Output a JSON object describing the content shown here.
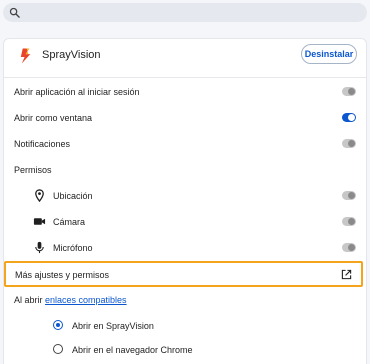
{
  "search": {
    "icon": "search-icon"
  },
  "app": {
    "name": "SprayVision",
    "logo_icon": "sprayvision-logo-icon",
    "uninstall_label": "Desinstalar"
  },
  "settings": [
    {
      "label": "Abrir aplicación al iniciar sesión",
      "enabled": false
    },
    {
      "label": "Abrir como ventana",
      "enabled": true
    },
    {
      "label": "Notificaciones",
      "enabled": false
    }
  ],
  "permissions": {
    "heading": "Permisos",
    "items": [
      {
        "label": "Ubicación",
        "icon": "location-pin-icon",
        "enabled": false
      },
      {
        "label": "Cámara",
        "icon": "camera-icon",
        "enabled": false
      },
      {
        "label": "Micrófono",
        "icon": "microphone-icon",
        "enabled": false
      }
    ]
  },
  "more_settings": {
    "label": "Más ajustes y permisos",
    "icon": "open-in-new-icon"
  },
  "open_links": {
    "prefix": "Al abrir ",
    "link_text": "enlaces compatibles",
    "options": [
      {
        "label": "Abrir en SprayVision",
        "selected": true
      },
      {
        "label": "Abrir en el navegador Chrome",
        "selected": false
      }
    ]
  },
  "colors": {
    "accent": "#0b57d0",
    "highlight": "#f4a51c",
    "toggle_off": "#c7c7c7"
  }
}
